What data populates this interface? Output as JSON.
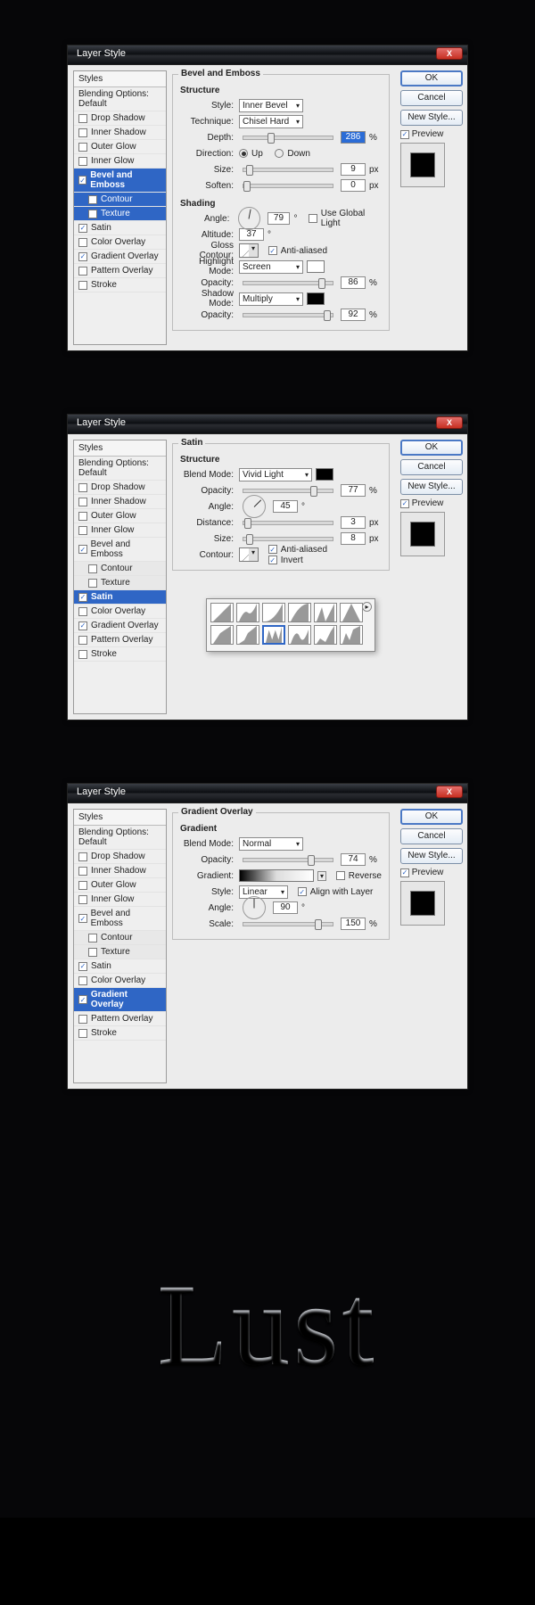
{
  "common": {
    "window_title": "Layer Style",
    "styles_header": "Styles",
    "blending_opts": "Blending Options: Default",
    "ok": "OK",
    "cancel": "Cancel",
    "new_style": "New Style...",
    "preview": "Preview",
    "effects": {
      "drop_shadow": "Drop Shadow",
      "inner_shadow": "Inner Shadow",
      "outer_glow": "Outer Glow",
      "inner_glow": "Inner Glow",
      "bevel": "Bevel and Emboss",
      "contour": "Contour",
      "texture": "Texture",
      "satin": "Satin",
      "color_ov": "Color Overlay",
      "grad_ov": "Gradient Overlay",
      "pat_ov": "Pattern Overlay",
      "stroke": "Stroke"
    }
  },
  "dlg1": {
    "title": "Bevel and Emboss",
    "structure": "Structure",
    "shading": "Shading",
    "style_lbl": "Style:",
    "style_v": "Inner Bevel",
    "tech_lbl": "Technique:",
    "tech_v": "Chisel Hard",
    "depth_lbl": "Depth:",
    "depth_v": "286",
    "depth_u": "%",
    "dir_lbl": "Direction:",
    "up": "Up",
    "down": "Down",
    "size_lbl": "Size:",
    "size_v": "9",
    "size_u": "px",
    "soft_lbl": "Soften:",
    "soft_v": "0",
    "soft_u": "px",
    "angle_lbl": "Angle:",
    "angle_v": "79",
    "angle_u": "°",
    "global": "Use Global Light",
    "alt_lbl": "Altitude:",
    "alt_v": "37",
    "alt_u": "°",
    "gc_lbl": "Gloss Contour:",
    "aa": "Anti-aliased",
    "hm_lbl": "Highlight Mode:",
    "hm_v": "Screen",
    "op_lbl": "Opacity:",
    "hm_op": "86",
    "op_u": "%",
    "sm_lbl": "Shadow Mode:",
    "sm_v": "Multiply",
    "sm_op": "92"
  },
  "dlg2": {
    "title": "Satin",
    "structure": "Structure",
    "bm_lbl": "Blend Mode:",
    "bm_v": "Vivid Light",
    "op_lbl": "Opacity:",
    "op_v": "77",
    "op_u": "%",
    "angle_lbl": "Angle:",
    "angle_v": "45",
    "angle_u": "°",
    "dist_lbl": "Distance:",
    "dist_v": "3",
    "dist_u": "px",
    "size_lbl": "Size:",
    "size_v": "8",
    "size_u": "px",
    "contour_lbl": "Contour:",
    "aa": "Anti-aliased",
    "invert": "Invert"
  },
  "dlg3": {
    "title": "Gradient Overlay",
    "gradient": "Gradient",
    "bm_lbl": "Blend Mode:",
    "bm_v": "Normal",
    "op_lbl": "Opacity:",
    "op_v": "74",
    "op_u": "%",
    "grad_lbl": "Gradient:",
    "reverse": "Reverse",
    "style_lbl": "Style:",
    "style_v": "Linear",
    "align": "Align with Layer",
    "angle_lbl": "Angle:",
    "angle_v": "90",
    "angle_u": "°",
    "scale_lbl": "Scale:",
    "scale_v": "150",
    "scale_u": "%"
  },
  "lust": "Lust"
}
